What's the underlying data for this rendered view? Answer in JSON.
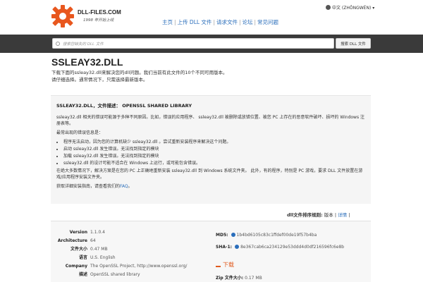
{
  "header": {
    "logo_text": "DLL-FILES.COM",
    "logo_sub": "1998 年开始上线",
    "language": "中文 (ZHŌNGWÉN) ▾",
    "nav": [
      "主页",
      "上传 DLL 文件",
      "请求文件",
      "论坛",
      "常见问题"
    ]
  },
  "search": {
    "placeholder": "搜索您缺失的 DLL 文件",
    "button": "搜索 DLL 文件"
  },
  "page": {
    "title": "SSLEAY32.DLL",
    "intro_1": "下载下面的ssleay32.dll来解决您的dll问题。我们当前有此文件的10个不同可用版本。",
    "intro_2": "请仔细选择。通常情况下，只需选择最新版本。"
  },
  "panel": {
    "title": "SSLEAY32.DLL，文件描述： OPENSSL SHARED LIBRARY",
    "p1": "ssleay32.dll 相关的错误可能源于多种不同原因。比如，错误的应用程序、 ssleay32.dll 被删除或放错位置、被您 PC 上存在的恶意软件破坏、损坏的 Windows 注册表等。",
    "p2": "最常出现的错误信息是：",
    "errors": [
      "程序无法启动，因为您的计算机缺少 ssleay32.dll 。尝试重新安装程序来解决这个问题。",
      "启动 ssleay32.dll 发生错误。无法找到指定的模块",
      "加载 ssleay32.dll 发生错误。无法找到指定的模块",
      "ssleay32.dll 的设计可能不适合在 Windows 上运行，或可能包含错误。"
    ],
    "p3": "在绝大多数情况下，解决方案是在您的 PC 上正确地重新安装 ssleay32.dll 到 Windows 系统文件夹。 此外，有的程序，特别是 PC 游戏，要求 DLL 文件放置在游戏/应用程序安装文件夹。",
    "p4_prefix": "获取详细安装指南，请查看我们的",
    "p4_link": "FAQ",
    "p4_suffix": "。"
  },
  "sort": {
    "label": "dll文件排序规则:",
    "opt1": "版本",
    "sep": "|",
    "opt2": "详情",
    "opt3": "|"
  },
  "details": {
    "version_k": "Version",
    "version_v": "1.1.0.4",
    "arch_k": "Architecture",
    "arch_v": "64",
    "size_k": "文件大小",
    "size_v": "0.47 MB",
    "lang_k": "语言",
    "lang_v": "U.S. English",
    "company_k": "Company",
    "company_v": "The OpenSSL Project, http://www.openssl.org/",
    "desc_k": "描述",
    "desc_v": "OpenSSL shared library",
    "md5_k": "MD5:",
    "md5_v": "1b4bd6105c83c1ffdef00de19f57b4ba",
    "sha1_k": "SHA-1:",
    "sha1_v": "8e367cab6ca234129e53ddd4d0df216596fc6e8b",
    "download": "下载",
    "zip_k": "Zip 文件大小:",
    "zip_v": "0.17 MB"
  },
  "colors": {
    "accent_orange": "#e05a1e",
    "link_blue": "#2a6ebb",
    "searchbar": "#3a3a3a"
  }
}
